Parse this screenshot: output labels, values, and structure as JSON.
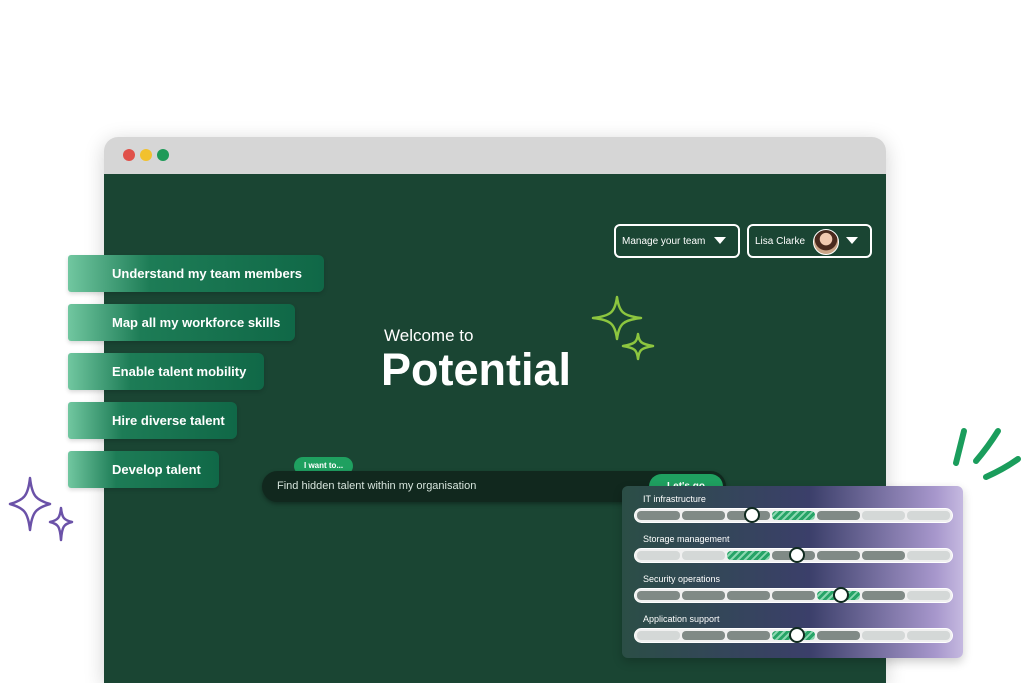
{
  "window": {
    "controls": [
      "close",
      "minimize",
      "zoom"
    ]
  },
  "header": {
    "team_menu_label": "Manage your team",
    "user_name": "Lisa Clarke"
  },
  "hero": {
    "welcome": "Welcome to",
    "brand": "Potential"
  },
  "search": {
    "chip": "I want to...",
    "value": "Find hidden talent within my organisation",
    "button": "Let's go"
  },
  "goals": [
    "Understand my team members",
    "Map all my workforce skills",
    "Enable talent mobility",
    "Hire diverse talent",
    "Develop talent"
  ],
  "skills": [
    {
      "name": "IT infrastructure",
      "segments": [
        "d",
        "d",
        "d",
        "h",
        "d",
        "l",
        "l"
      ],
      "level": 0.37
    },
    {
      "name": "Storage management",
      "segments": [
        "l",
        "l",
        "h",
        "d",
        "d",
        "d",
        "l"
      ],
      "level": 0.51
    },
    {
      "name": "Security operations",
      "segments": [
        "d",
        "d",
        "d",
        "d",
        "h",
        "d",
        "l"
      ],
      "level": 0.65
    },
    {
      "name": "Application support",
      "segments": [
        "l",
        "d",
        "d",
        "h",
        "d",
        "l",
        "l"
      ],
      "level": 0.51
    }
  ],
  "colors": {
    "background": "#1a4533",
    "accent": "#1fa060",
    "sparkle_green": "#8dc63f",
    "sparkle_purple": "#6b52a8"
  }
}
